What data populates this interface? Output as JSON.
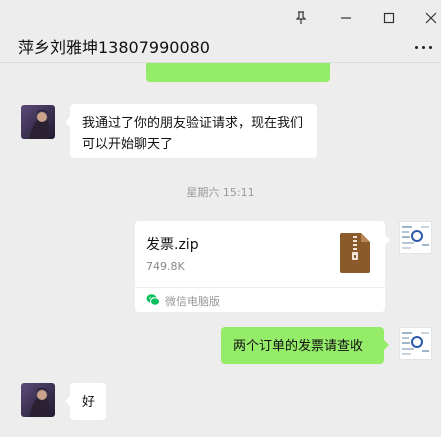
{
  "window": {
    "title": "萍乡刘雅坤13807990080"
  },
  "messages": [
    {
      "side": "left",
      "type": "text",
      "text": "我通过了你的朋友验证请求，现在我们可以开始聊天了"
    },
    {
      "type": "time",
      "text": "星期六 15:11"
    },
    {
      "side": "right",
      "type": "file",
      "file_name": "发票.zip",
      "file_size": "749.8K",
      "source": "微信电脑版"
    },
    {
      "side": "right",
      "type": "text",
      "text": "两个订单的发票请查收"
    },
    {
      "side": "left",
      "type": "text",
      "text": "好"
    }
  ],
  "colors": {
    "background": "#ededed",
    "bubble_self": "#95ec69",
    "bubble_other": "#ffffff",
    "zip_icon": "#8b5a2b"
  }
}
